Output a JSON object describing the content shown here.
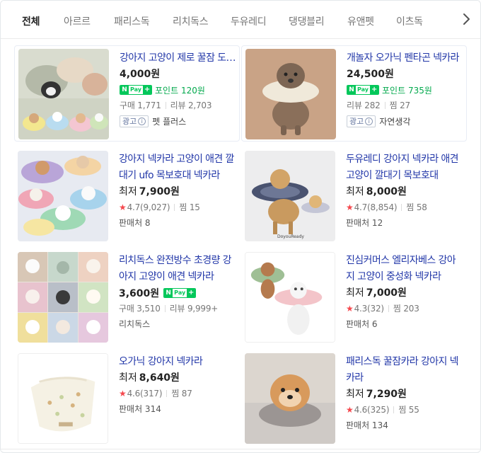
{
  "tabs": [
    "전체",
    "아르르",
    "패리스독",
    "리치독스",
    "두유레디",
    "댕댕블리",
    "유앤펫",
    "이츠독"
  ],
  "products": [
    {
      "title": "강아지 고양이 제로 꿀잠 도넛 넥카라",
      "price_prefix": "",
      "price": "4,000원",
      "npay": true,
      "point": "포인트 120원",
      "meta": [
        "구매 1,771",
        "리뷰 2,703"
      ],
      "ad": true,
      "seller": "펫 플러스"
    },
    {
      "title": "개놀자 오가닉 펜타곤 넥카라",
      "price_prefix": "",
      "price": "24,500원",
      "npay": true,
      "point": "포인트 735원",
      "meta": [
        "리뷰 282",
        "찜 27"
      ],
      "ad": true,
      "seller": "자연생각"
    },
    {
      "title": "강아지 넥카라 고양이 애견 깔대기 ufo 목보호대 넥카라",
      "price_prefix": "최저",
      "price": "7,900원",
      "rating": "4.7(9,027)",
      "zzim": "찜 15",
      "seller": "판매처 8"
    },
    {
      "title": "두유레디 강아지 넥카라 애견 고양이 깔대기 목보호대",
      "price_prefix": "최저",
      "price": "8,000원",
      "rating": "4.7(8,854)",
      "zzim": "찜 58",
      "seller": "판매처 12"
    },
    {
      "title": "리치독스 완전방수 초경량 강아지 고양이 애견 넥카라",
      "price_prefix": "",
      "price": "3,600원",
      "npay": true,
      "point": "",
      "meta": [
        "구매 3,510",
        "리뷰 9,999+"
      ],
      "seller": "리치독스"
    },
    {
      "title": "진심커머스 엘리자베스 강아지 고양이 중성화 넥카라",
      "price_prefix": "최저",
      "price": "7,000원",
      "rating": "4.3(32)",
      "zzim": "찜 203",
      "seller": "판매처 6"
    },
    {
      "title": "오가닉 강아지 넥카라",
      "price_prefix": "최저",
      "price": "8,640원",
      "rating": "4.6(317)",
      "zzim": "찜 87",
      "seller": "판매처 314"
    },
    {
      "title": "패리스독 꿀잠카라 강아지 넥카라",
      "price_prefix": "최저",
      "price": "7,290원",
      "rating": "4.6(325)",
      "zzim": "찜 55",
      "seller": "판매처 134"
    }
  ],
  "labels": {
    "ad": "광고",
    "npay_n": "N",
    "npay_pay": "Pay",
    "npay_plus": "+"
  },
  "icons": [
    "chevron-right-icon",
    "star-icon",
    "info-icon"
  ],
  "colors": {
    "link": "#2237a8",
    "npay": "#03c75a",
    "star": "#f5484d"
  }
}
